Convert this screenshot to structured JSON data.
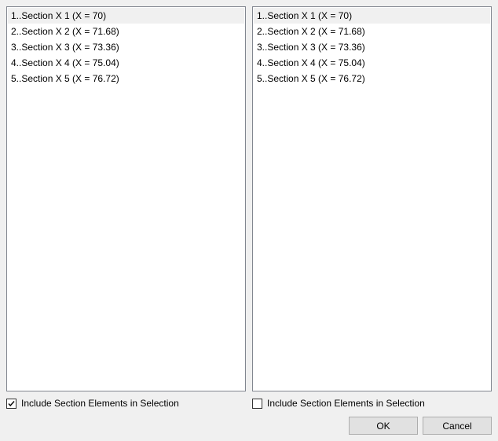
{
  "left": {
    "items": [
      "1..Section X 1 (X = 70)",
      "2..Section X 2 (X = 71.68)",
      "3..Section X 3 (X = 73.36)",
      "4..Section X 4 (X = 75.04)",
      "5..Section X 5 (X = 76.72)"
    ],
    "selected_index": 0,
    "checkbox_label": "Include Section Elements in Selection",
    "checkbox_checked": true
  },
  "right": {
    "items": [
      "1..Section X 1 (X = 70)",
      "2..Section X 2 (X = 71.68)",
      "3..Section X 3 (X = 73.36)",
      "4..Section X 4 (X = 75.04)",
      "5..Section X 5 (X = 76.72)"
    ],
    "selected_index": 0,
    "checkbox_label": "Include Section Elements in Selection",
    "checkbox_checked": false
  },
  "buttons": {
    "ok": "OK",
    "cancel": "Cancel"
  }
}
